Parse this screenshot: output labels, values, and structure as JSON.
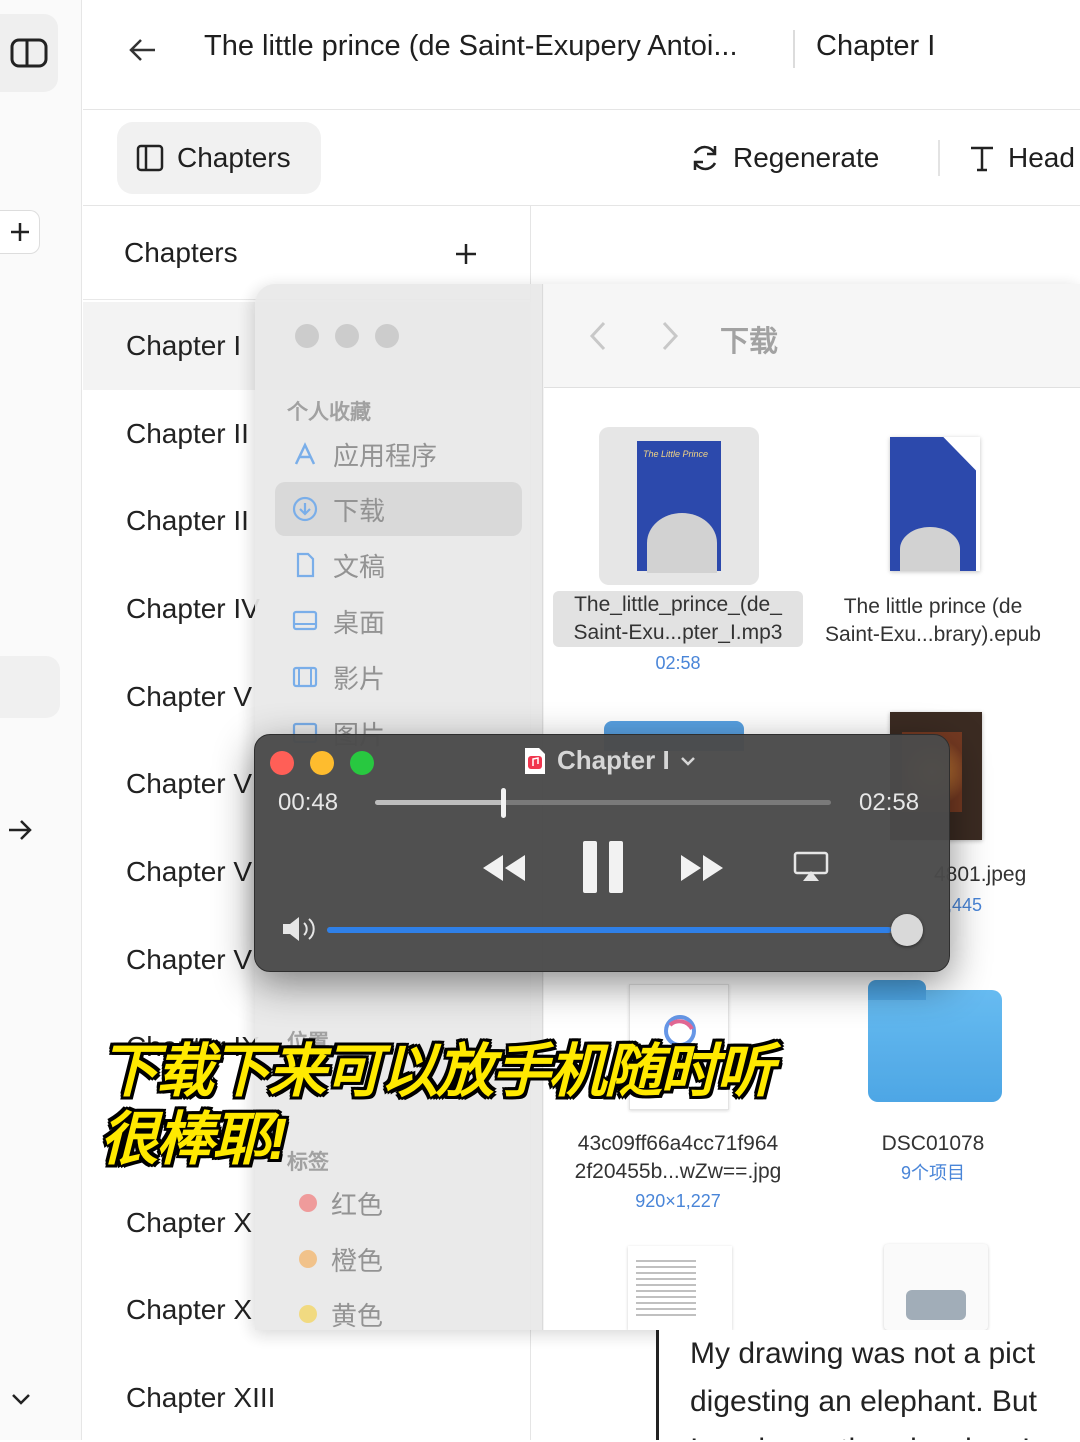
{
  "header": {
    "title": "The little prince (de Saint-Exupery Antoi...",
    "chapter": "Chapter I"
  },
  "toolbar": {
    "chapters_tab": "Chapters",
    "regenerate": "Regenerate",
    "head": "Head"
  },
  "sidebar": {
    "title": "Chapters",
    "items": [
      "Chapter I",
      "Chapter II",
      "Chapter II",
      "Chapter IV",
      "Chapter V",
      "Chapter V",
      "Chapter V",
      "Chapter V",
      "Chapter IX",
      "Chapter X",
      "Chapter X",
      "Chapter X",
      "Chapter XIII"
    ]
  },
  "finder": {
    "location": "下载",
    "sections": {
      "favorites": "个人收藏",
      "locations": "位置",
      "tags": "标签"
    },
    "favorites": [
      "应用程序",
      "下载",
      "文稿",
      "桌面",
      "影片",
      "图片"
    ],
    "tags": [
      {
        "label": "红色",
        "color": "#f25a5a"
      },
      {
        "label": "橙色",
        "color": "#f5a03c"
      },
      {
        "label": "黄色",
        "color": "#f5cc2c"
      }
    ],
    "files": [
      {
        "name1": "The_little_prince_(de_",
        "name2": "Saint-Exu...pter_I.mp3",
        "sub": "02:58"
      },
      {
        "name1": "The little prince (de",
        "name2": "Saint-Exu...brary).epub",
        "sub": ""
      },
      {
        "name1": "",
        "name2": "4801.jpeg",
        "sub": ",445"
      },
      {
        "name1": "43c09ff66a4cc71f964",
        "name2": "2f20455b...wZw==.jpg",
        "sub": "920×1,227"
      },
      {
        "name1": "DSC01078",
        "name2": "",
        "sub": "9个项目"
      }
    ]
  },
  "player": {
    "title": "Chapter I",
    "elapsed": "00:48",
    "total": "02:58",
    "progress": 0.28,
    "volume": 1.0
  },
  "caption": {
    "line1": "下载下来可以放手机随时听",
    "line2": "很棒耶!"
  },
  "reader": {
    "line1": "My drawing was not a pict",
    "line2": "digesting an elephant. But",
    "line3": "I made another drawing: I"
  }
}
